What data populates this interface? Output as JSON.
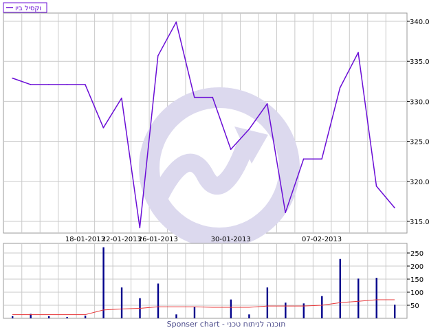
{
  "colors": {
    "price_line": "#6a0dd6",
    "volume_bar": "#00008b",
    "volume_avg": "#e8383a",
    "grid": "#c9c9c9",
    "panel_border": "#9a9a9a",
    "legend_text": "#6a0dd6",
    "footer_text": "#4a4a8a",
    "watermark": "#dcd9ee"
  },
  "footer": {
    "text": "Sponser chart - תוכנה לניתוח טכני"
  },
  "watermark_icon": "rising-arrow-circle-icon",
  "chart_data": [
    {
      "type": "line",
      "legend": [
        "וקסיל ביו"
      ],
      "legend_position": "top-left",
      "grid": true,
      "y_axis_side": "right",
      "ylim": [
        313.5,
        341.5
      ],
      "yticks": [
        315.0,
        320.0,
        325.0,
        330.0,
        335.0,
        340.0
      ],
      "ytick_labels": [
        "315.0",
        "320.0",
        "325.0",
        "330.0",
        "335.0",
        "340.0"
      ],
      "x_tick_labels": [
        {
          "index": 4,
          "label": "18-01-2013"
        },
        {
          "index": 6,
          "label": "22-01-2013"
        },
        {
          "index": 8,
          "label": "26-01-2013"
        },
        {
          "index": 12,
          "label": "30-01-2013"
        },
        {
          "index": 17,
          "label": "07-02-2013"
        }
      ],
      "series": [
        {
          "name": "וקסיל ביו",
          "values": [
            332.9,
            332.1,
            332.1,
            332.1,
            332.1,
            326.7,
            330.4,
            314.2,
            335.7,
            339.9,
            330.5,
            330.5,
            324.0,
            326.5,
            329.7,
            316.1,
            322.8,
            322.8,
            331.7,
            336.1,
            319.4,
            316.7
          ]
        }
      ]
    },
    {
      "type": "bar",
      "grid": true,
      "y_axis_side": "right",
      "ylim": [
        0,
        275
      ],
      "yticks": [
        50,
        100,
        150,
        200,
        250
      ],
      "ytick_labels": [
        "50",
        "100",
        "150",
        "200",
        "250"
      ],
      "series": [
        {
          "values": [
            8,
            17,
            8,
            5,
            10,
            272,
            118,
            77,
            133,
            15,
            43,
            0,
            72,
            15,
            118,
            60,
            57,
            85,
            227,
            152,
            155,
            52
          ]
        },
        {
          "values": [
            14,
            14,
            14,
            14,
            14,
            32,
            36,
            38,
            44,
            44,
            44,
            42,
            42,
            42,
            47,
            47,
            47,
            50,
            60,
            65,
            71,
            71
          ]
        }
      ]
    }
  ]
}
